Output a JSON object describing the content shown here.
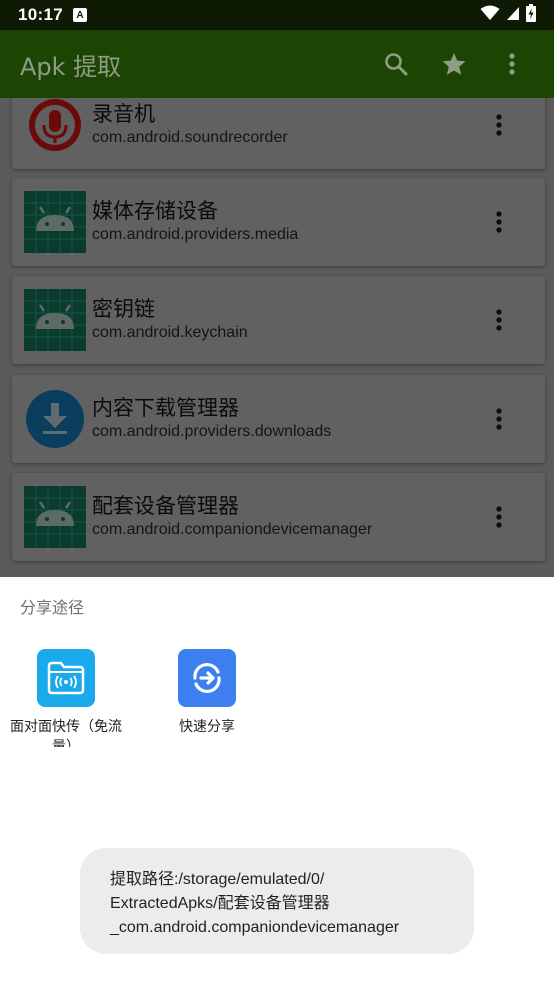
{
  "status_bar": {
    "time": "10:17",
    "notification_badge": "A",
    "icons": [
      "wifi-icon",
      "signal-icon",
      "battery-charging-icon"
    ]
  },
  "app_bar": {
    "title": "Apk 提取",
    "actions": [
      "search-icon",
      "star-icon",
      "more-vert-icon"
    ]
  },
  "app_list": [
    {
      "name": "录音机",
      "package": "com.android.soundrecorder",
      "icon": "sound-recorder-icon"
    },
    {
      "name": "媒体存储设备",
      "package": "com.android.providers.media",
      "icon": "android-icon"
    },
    {
      "name": "密钥链",
      "package": "com.android.keychain",
      "icon": "android-icon"
    },
    {
      "name": "内容下载管理器",
      "package": "com.android.providers.downloads",
      "icon": "download-icon"
    },
    {
      "name": "配套设备管理器",
      "package": "com.android.companiondevicemanager",
      "icon": "android-icon"
    }
  ],
  "share_sheet": {
    "title": "分享途径",
    "options": [
      {
        "label": "面对面快传（免流量）",
        "icon": "nearby-share-folder-icon",
        "color": "#1aa9ea"
      },
      {
        "label": "快速分享",
        "icon": "quick-share-icon",
        "color": "#3d7ff0"
      }
    ]
  },
  "toast": {
    "lines": [
      "提取路径:/storage/emulated/0/",
      "ExtractedApks/配套设备管理器",
      "_com.android.companiondevicemanager"
    ]
  },
  "colors": {
    "app_bar": "#1c4504",
    "status_bar": "#0f1a05",
    "overlay": "#5b5b5b",
    "toast_bg": "#ececec"
  }
}
